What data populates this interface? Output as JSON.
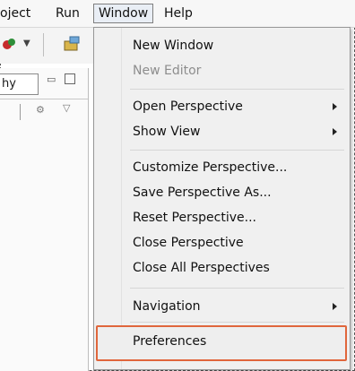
{
  "menubar": {
    "items": [
      "oject",
      "Run",
      "Window",
      "Help"
    ]
  },
  "sidepanel": {
    "tab_label": "hy"
  },
  "window_menu": {
    "new_window": "New Window",
    "new_editor": "New Editor",
    "open_perspective": "Open Perspective",
    "show_view": "Show View",
    "customize_perspective": "Customize Perspective...",
    "save_perspective_as": "Save Perspective As...",
    "reset_perspective": "Reset Perspective...",
    "close_perspective": "Close Perspective",
    "close_all_perspectives": "Close All Perspectives",
    "navigation": "Navigation",
    "preferences": "Preferences"
  },
  "colors": {
    "highlight_border": "#e0663c",
    "menu_background": "#f0f0f0",
    "disabled_text": "#8d8d8d"
  }
}
